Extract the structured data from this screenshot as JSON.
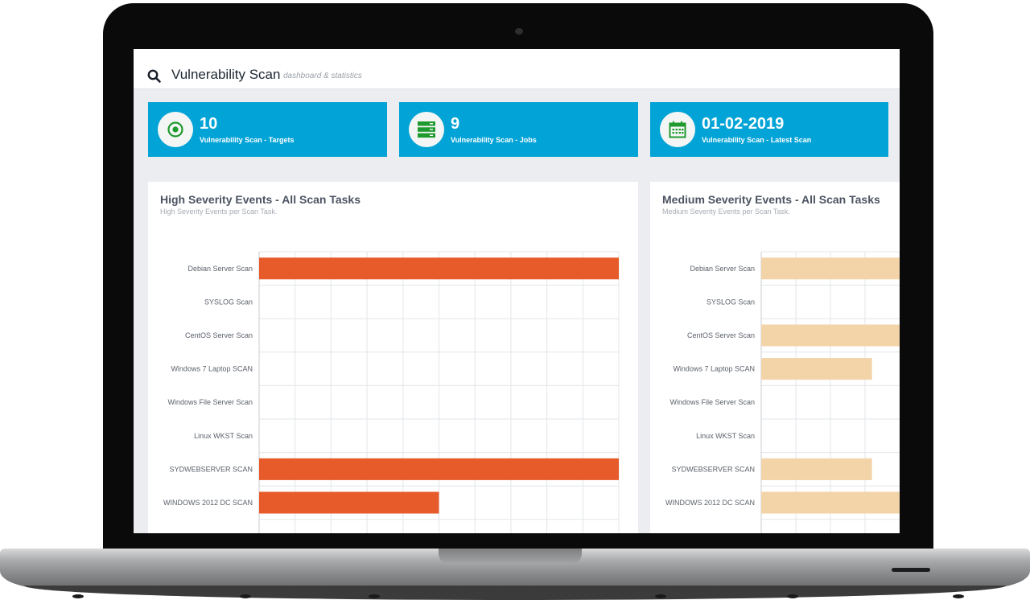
{
  "header": {
    "title": "Vulnerability Scan",
    "subtitle": "dashboard & statistics"
  },
  "stats": [
    {
      "value": "10",
      "label": "Vulnerability Scan - Targets",
      "icon": "target-icon"
    },
    {
      "value": "9",
      "label": "Vulnerability Scan - Jobs",
      "icon": "server-stack-icon"
    },
    {
      "value": "01-02-2019",
      "label": "Vulnerability Scan - Latest Scan",
      "icon": "calendar-icon"
    }
  ],
  "panels": {
    "high": {
      "title": "High Severity Events - All Scan Tasks",
      "subtitle": "High Severity Events per Scan Task."
    },
    "medium": {
      "title": "Medium Severity Events - All Scan Tasks",
      "subtitle": "Medium Severity Events per Scan Task."
    }
  },
  "colors": {
    "accent": "#02a3d6",
    "icon_green": "#1f9a2e",
    "high_bar": "#e75b2a",
    "medium_bar": "#f3d3a8"
  },
  "chart_data": [
    {
      "type": "bar",
      "orientation": "horizontal",
      "categories": [
        "Debian Server Scan",
        "SYSLOG Scan",
        "CentOS Server Scan",
        "Windows 7 Laptop SCAN",
        "Windows File Server Scan",
        "Linux WKST Scan",
        "SYDWEBSERVER SCAN",
        "WINDOWS 2012 DC SCAN"
      ],
      "values": [
        10,
        0,
        0,
        0,
        0,
        0,
        10,
        5
      ],
      "xlim": [
        0,
        10
      ],
      "grid": true
    },
    {
      "type": "bar",
      "orientation": "horizontal",
      "categories": [
        "Debian Server Scan",
        "SYSLOG Scan",
        "CentOS Server Scan",
        "Windows 7 Laptop SCAN",
        "Windows File Server Scan",
        "Linux WKST Scan",
        "SYDWEBSERVER SCAN",
        "WINDOWS 2012 DC SCAN"
      ],
      "values": [
        10,
        0,
        10,
        8,
        0,
        0,
        8,
        10
      ],
      "xlim": [
        0,
        10
      ],
      "grid": true
    }
  ]
}
